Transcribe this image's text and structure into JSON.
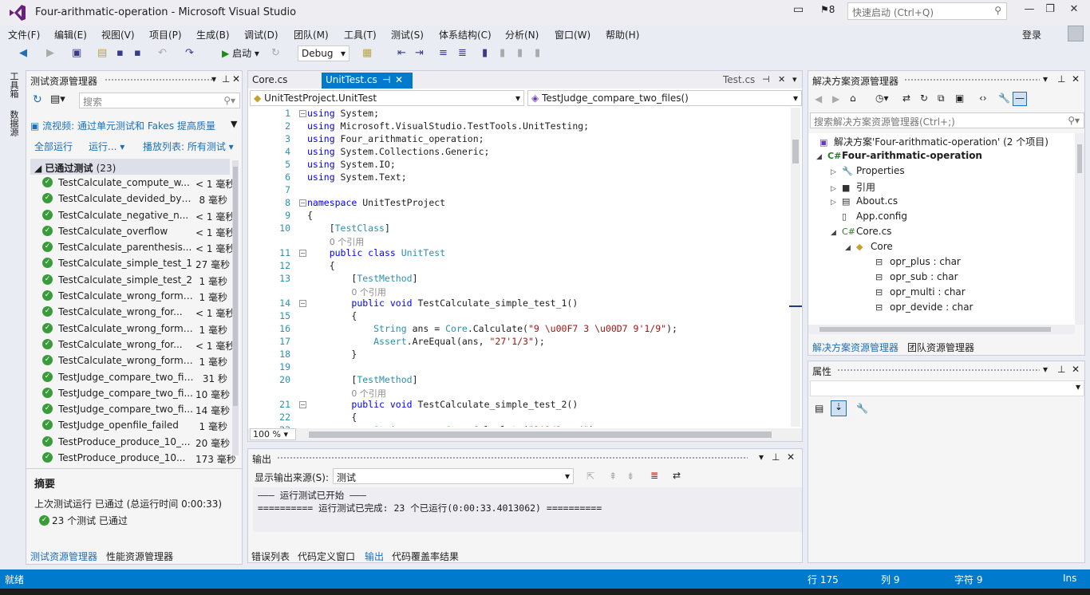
{
  "window": {
    "title": "Four-arithmatic-operation - Microsoft Visual Studio",
    "notif_count": "8",
    "quick_launch_placeholder": "快速启动 (Ctrl+Q)",
    "login": "登录"
  },
  "menu": [
    "文件(F)",
    "编辑(E)",
    "视图(V)",
    "项目(P)",
    "生成(B)",
    "调试(D)",
    "团队(M)",
    "工具(T)",
    "测试(S)",
    "体系结构(C)",
    "分析(N)",
    "窗口(W)",
    "帮助(H)"
  ],
  "toolbar": {
    "run_label": "启动",
    "config": "Debug"
  },
  "vtabs": [
    "工具箱",
    "数据源"
  ],
  "test_explorer": {
    "title": "测试资源管理器",
    "search_placeholder": "搜索",
    "stream_link": "流视频: 通过单元测试和 Fakes 提高质量",
    "run_all": "全部运行",
    "run": "运行...",
    "playlist": "播放列表: 所有测试",
    "group_label": "已通过测试",
    "group_count": "(23)",
    "tests": [
      {
        "name": "TestCalculate_compute_w...",
        "dur": "< 1 毫秒"
      },
      {
        "name": "TestCalculate_devided_by_z...",
        "dur": "8 毫秒"
      },
      {
        "name": "TestCalculate_negative_n...",
        "dur": "< 1 毫秒"
      },
      {
        "name": "TestCalculate_overflow",
        "dur": "< 1 毫秒"
      },
      {
        "name": "TestCalculate_parenthesis...",
        "dur": "< 1 毫秒"
      },
      {
        "name": "TestCalculate_simple_test_1",
        "dur": "27 毫秒"
      },
      {
        "name": "TestCalculate_simple_test_2",
        "dur": "1 毫秒"
      },
      {
        "name": "TestCalculate_wrong_format...",
        "dur": "1 毫秒"
      },
      {
        "name": "TestCalculate_wrong_for...",
        "dur": "< 1 毫秒"
      },
      {
        "name": "TestCalculate_wrong_format...",
        "dur": "1 毫秒"
      },
      {
        "name": "TestCalculate_wrong_for...",
        "dur": "< 1 毫秒"
      },
      {
        "name": "TestCalculate_wrong_format...",
        "dur": "1 毫秒"
      },
      {
        "name": "TestJudge_compare_two_files",
        "dur": "31 秒"
      },
      {
        "name": "TestJudge_compare_two_fi...",
        "dur": "10 毫秒"
      },
      {
        "name": "TestJudge_compare_two_fi...",
        "dur": "14 毫秒"
      },
      {
        "name": "TestJudge_openfile_failed",
        "dur": "1 毫秒"
      },
      {
        "name": "TestProduce_produce_10_...",
        "dur": "20 毫秒"
      },
      {
        "name": "TestProduce_produce_10...",
        "dur": "173 毫秒"
      }
    ],
    "summary_title": "摘要",
    "summary_last": "上次测试运行 已通过 (总运行时间 0:00:33)",
    "summary_passed": "23 个测试 已通过",
    "tabs": [
      "测试资源管理器",
      "性能资源管理器"
    ]
  },
  "editor": {
    "tabs": [
      "Core.cs",
      "UnitTest.cs",
      "Test.cs"
    ],
    "nav_class": "UnitTestProject.UnitTest",
    "nav_member": "TestJudge_compare_two_files()",
    "zoom": "100 %",
    "line_numbers": [
      "1",
      "2",
      "3",
      "4",
      "5",
      "6",
      "7",
      "8",
      "9",
      "10",
      "",
      "11",
      "12",
      "13",
      "",
      "14",
      "15",
      "16",
      "17",
      "18",
      "19",
      "20",
      "",
      "21",
      "22",
      "23"
    ]
  },
  "output": {
    "title": "输出",
    "source_label": "显示输出来源(S):",
    "source_value": "测试",
    "lines": [
      "——— 运行测试已开始 ———",
      "========== 运行测试已完成: 23 个已运行(0:00:33.4013062) =========="
    ],
    "tabs": [
      "错误列表",
      "代码定义窗口",
      "输出",
      "代码覆盖率结果"
    ]
  },
  "solution_explorer": {
    "title": "解决方案资源管理器",
    "search_placeholder": "搜索解决方案资源管理器(Ctrl+;)",
    "items": [
      "解决方案'Four-arithmatic-operation' (2 个项目)",
      "Four-arithmatic-operation",
      "Properties",
      "引用",
      "About.cs",
      "App.config",
      "Core.cs",
      "Core",
      "opr_plus : char",
      "opr_sub : char",
      "opr_multi : char",
      "opr_devide : char"
    ],
    "tabs": [
      "解决方案资源管理器",
      "团队资源管理器"
    ]
  },
  "properties": {
    "title": "属性"
  },
  "status": {
    "ready": "就绪",
    "line": "行 175",
    "col": "列 9",
    "char": "字符 9",
    "mode": "Ins"
  },
  "colors": {
    "accent": "#007acc",
    "pass": "#3a9b3a",
    "keyword": "#0000ff",
    "type": "#2b91af",
    "string": "#a31515"
  }
}
